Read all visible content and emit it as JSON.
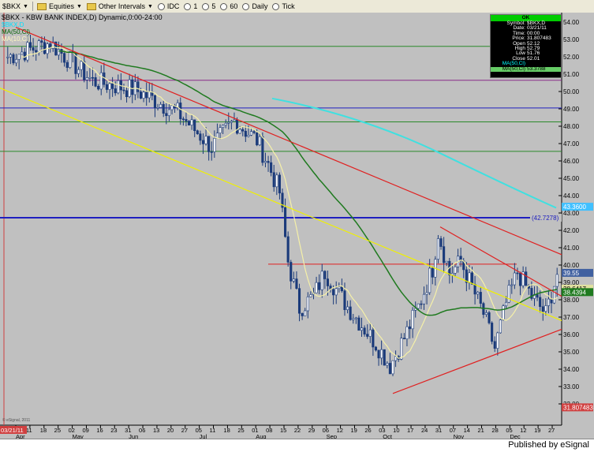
{
  "toolbar": {
    "symbol_label": "$BKX",
    "items": [
      {
        "label": "Equities",
        "dropdown": true
      },
      {
        "label": "Other Intervals",
        "dropdown": true
      },
      {
        "label": "IDC"
      },
      {
        "label": "1"
      },
      {
        "label": "5"
      },
      {
        "label": "60"
      },
      {
        "label": "Daily"
      },
      {
        "label": "Tick"
      }
    ]
  },
  "chart": {
    "title": "$BKX - KBW BANK INDEX,D) Dynamic,0:00-24:00",
    "legend": [
      "$BKX,D",
      "MA(50,Cl)",
      "MA(10,Cl)"
    ],
    "price_scale": [
      "54.00",
      "53.00",
      "52.00",
      "51.00",
      "50.00",
      "49.00",
      "48.00",
      "47.00",
      "46.00",
      "45.00",
      "44.00",
      "43.00",
      "42.00",
      "41.00",
      "40.00",
      "39.00",
      "38.00",
      "37.00",
      "36.00",
      "35.00",
      "34.00",
      "33.00",
      "32.00"
    ],
    "month_labels": [
      "Apr",
      "May",
      "Jun",
      "Jul",
      "Aug",
      "Sep",
      "Oct",
      "Nov",
      "Dec"
    ],
    "day_labels": [
      "04",
      "11",
      "18",
      "25",
      "02",
      "09",
      "16",
      "23",
      "31",
      "06",
      "13",
      "20",
      "27",
      "05",
      "11",
      "18",
      "25",
      "01",
      "08",
      "15",
      "22",
      "29",
      "06",
      "12",
      "19",
      "26",
      "03",
      "10",
      "17",
      "24",
      "31",
      "07",
      "14",
      "21",
      "28",
      "05",
      "12",
      "19",
      "27"
    ],
    "price_badges": {
      "current": "39.55",
      "ma10": "38.6417",
      "ma50": "38.4394",
      "ma200": "43.3600",
      "hline": "(42.7278)",
      "start_price": "31.807483"
    },
    "start_date": "03/21/11",
    "bottom_left_note": "© eSignal, 2011"
  },
  "data_window": {
    "header": "OK",
    "rows": [
      {
        "k": "Symbol:",
        "v": "$BKX,D"
      },
      {
        "k": "Date:",
        "v": "03/21/11"
      },
      {
        "k": "Time:",
        "v": "00:00"
      },
      {
        "k": "Price:",
        "v": "31.807483"
      },
      {
        "k": "Open",
        "v": "52.12"
      },
      {
        "k": "High",
        "v": "52.79"
      },
      {
        "k": "Low",
        "v": "51.76"
      },
      {
        "k": "Close",
        "v": "52.01"
      }
    ],
    "ma_row_1": {
      "k": "MA(50,Cl)",
      "v": ""
    },
    "ma_row_2": {
      "k": "MA(50,Cl)",
      "v": "53.3788"
    }
  },
  "footer": {
    "text": "Published by eSignal"
  },
  "colors": {
    "background": "#c0c0c0",
    "candle": "#1a3a7a",
    "ma10": "#f5f0a8",
    "ma50": "#1f7a1f",
    "ma200": "#40e0e0",
    "trend_red": "#e02020",
    "trend_yellow": "#f0f000",
    "hline_blue": "#2020c0"
  }
}
